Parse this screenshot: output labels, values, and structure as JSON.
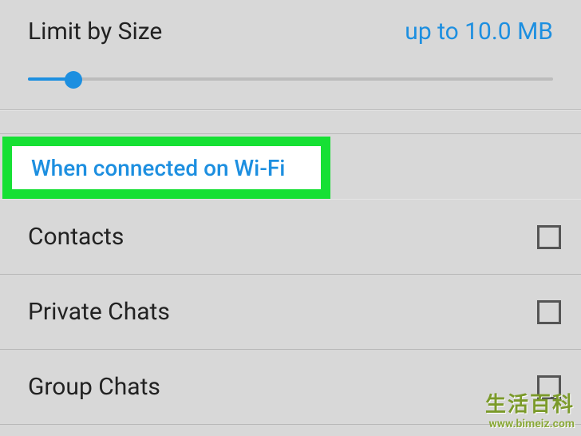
{
  "limit": {
    "label": "Limit by Size",
    "value": "up to 10.0 MB"
  },
  "section": {
    "header": "When connected on Wi-Fi"
  },
  "rows": [
    {
      "label": "Contacts"
    },
    {
      "label": "Private Chats"
    },
    {
      "label": "Group Chats"
    }
  ],
  "watermark": {
    "main": "生活百科",
    "url": "www.bimeiz.com"
  }
}
